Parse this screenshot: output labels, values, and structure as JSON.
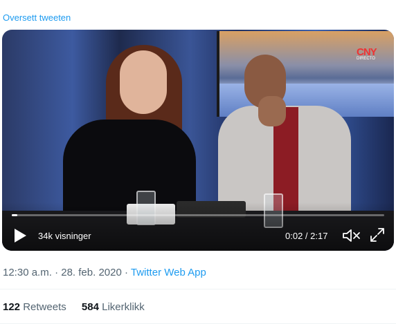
{
  "tweet": {
    "translate_label": "Oversett tweeten",
    "time": "12:30 a.m.",
    "separator": "·",
    "date": "28. feb. 2020",
    "source": "Twitter Web App"
  },
  "video": {
    "channel_logo": "CNY",
    "channel_logo_sub": "DIRECTO",
    "views": "34k visninger",
    "elapsed": "0:02",
    "duration": "2:17",
    "time_separator": " / ",
    "progress_fraction": 0.015,
    "icons": [
      "play-icon",
      "volume-muted-icon",
      "fullscreen-icon"
    ]
  },
  "stats": {
    "retweets_count": "122",
    "retweets_label": "Retweets",
    "likes_count": "584",
    "likes_label": "Likerklikk"
  },
  "colors": {
    "link": "#1d9bf0",
    "secondary_text": "#536471",
    "primary_text": "#0f1419"
  }
}
